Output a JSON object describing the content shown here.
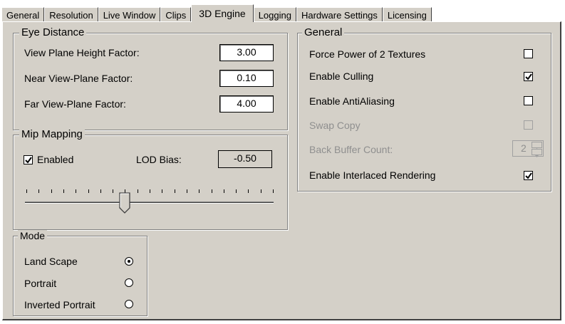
{
  "tabs": [
    {
      "label": "General"
    },
    {
      "label": "Resolution"
    },
    {
      "label": "Live Window"
    },
    {
      "label": "Clips"
    },
    {
      "label": "3D Engine"
    },
    {
      "label": "Logging"
    },
    {
      "label": "Hardware Settings"
    },
    {
      "label": "Licensing"
    }
  ],
  "active_tab": "3D Engine",
  "eye_distance": {
    "title": "Eye Distance",
    "rows": [
      {
        "label": "View Plane Height Factor:",
        "value": "3.00"
      },
      {
        "label": "Near View-Plane Factor:",
        "value": "0.10"
      },
      {
        "label": "Far View-Plane Factor:",
        "value": "4.00"
      }
    ]
  },
  "mip_mapping": {
    "title": "Mip Mapping",
    "enabled_label": "Enabled",
    "enabled_checked": true,
    "lod_bias_label": "LOD Bias:",
    "lod_bias_value": "-0.50",
    "slider_tick_count": 21,
    "slider_position_fraction": 0.4
  },
  "mode": {
    "title": "Mode",
    "options": [
      {
        "label": "Land Scape",
        "selected": true
      },
      {
        "label": "Portrait",
        "selected": false
      },
      {
        "label": "Inverted Portrait",
        "selected": false
      }
    ]
  },
  "general": {
    "title": "General",
    "options": [
      {
        "label": "Force Power of 2 Textures",
        "checked": false,
        "disabled": false
      },
      {
        "label": "Enable Culling",
        "checked": true,
        "disabled": false
      },
      {
        "label": "Enable AntiAliasing",
        "checked": false,
        "disabled": false
      },
      {
        "label": "Swap Copy",
        "checked": false,
        "disabled": true
      }
    ],
    "back_buffer_label": "Back Buffer Count:",
    "back_buffer_value": "2",
    "interlaced_label": "Enable Interlaced Rendering",
    "interlaced_checked": true
  },
  "colors": {
    "face": "#d4d0c8",
    "disabled_text": "#8f8f8f"
  }
}
